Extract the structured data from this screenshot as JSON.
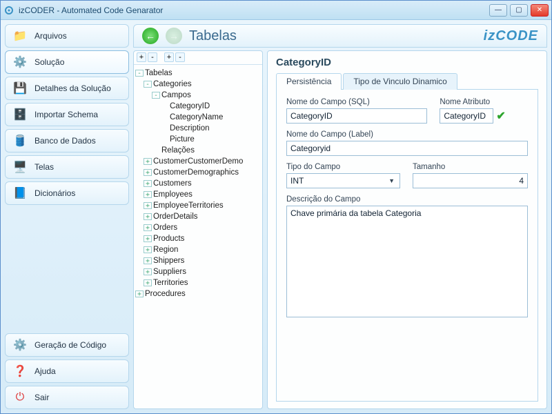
{
  "window": {
    "title": "izCODER - Automated Code Genarator"
  },
  "brand": "izCODE",
  "sidebar": {
    "items": [
      {
        "label": "Arquivos",
        "icon": "📁"
      },
      {
        "label": "Solução",
        "icon": "⚙️"
      },
      {
        "label": "Detalhes da Solução",
        "icon": "💾"
      },
      {
        "label": "Importar Schema",
        "icon": "🗄️"
      },
      {
        "label": "Banco de Dados",
        "icon": "🛢️"
      },
      {
        "label": "Telas",
        "icon": "🖥️"
      },
      {
        "label": "Dicionários",
        "icon": "📘"
      }
    ],
    "bottom": [
      {
        "label": "Geração de Código",
        "icon": "⚙️"
      },
      {
        "label": "Ajuda",
        "icon": "❓"
      },
      {
        "label": "Sair",
        "icon": "⏻"
      }
    ]
  },
  "main": {
    "title": "Tabelas"
  },
  "tree_toolbar": [
    "+",
    "-",
    "+",
    "-"
  ],
  "tree": {
    "root": "Tabelas",
    "categories": "Categories",
    "campos": "Campos",
    "c1": "CategoryID",
    "c2": "CategoryName",
    "c3": "Description",
    "c4": "Picture",
    "relacoes": "Relações",
    "others": [
      "CustomerCustomerDemo",
      "CustomerDemographics",
      "Customers",
      "Employees",
      "EmployeeTerritories",
      "OrderDetails",
      "Orders",
      "Products",
      "Region",
      "Shippers",
      "Suppliers",
      "Territories"
    ],
    "procedures": "Procedures"
  },
  "detail": {
    "title": "CategoryID",
    "tabs": {
      "t1": "Persistência",
      "t2": "Tipo de Vinculo Dinamico"
    },
    "labels": {
      "nome_sql": "Nome do Campo (SQL)",
      "nome_attr": "Nome Atributo",
      "nome_lbl": "Nome do Campo (Label)",
      "tipo": "Tipo do Campo",
      "tamanho": "Tamanho",
      "descricao": "Descrição do Campo"
    },
    "values": {
      "nome_sql": "CategoryID",
      "nome_attr": "CategoryID",
      "nome_lbl": "Categoryid",
      "tipo": "INT",
      "tamanho": "4",
      "descricao": "Chave primária da tabela Categoria"
    }
  }
}
